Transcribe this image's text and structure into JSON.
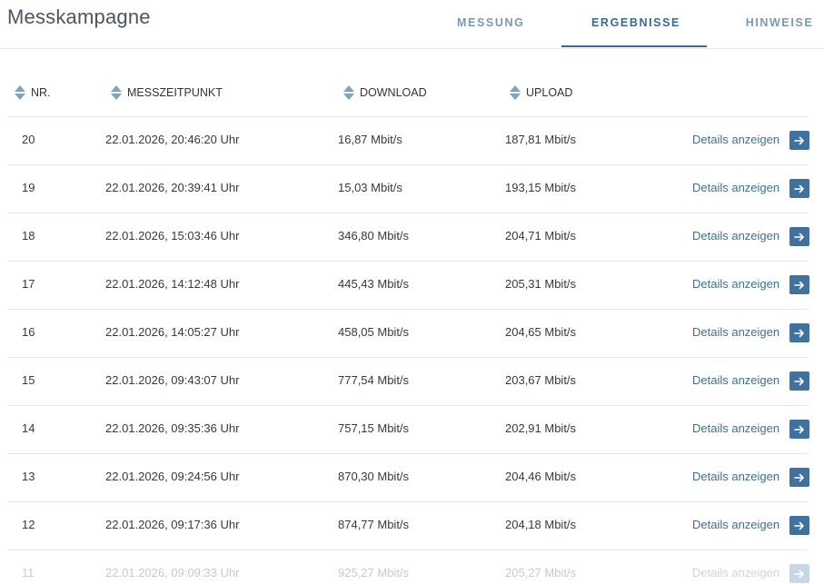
{
  "header": {
    "title": "Messkampagne",
    "tabs": [
      {
        "label": "MESSUNG",
        "active": false
      },
      {
        "label": "ERGEBNISSE",
        "active": true
      },
      {
        "label": "HINWEISE",
        "active": false
      }
    ]
  },
  "table": {
    "columns": [
      {
        "label": "NR.",
        "icon": "sort-icon"
      },
      {
        "label": "MESSZEITPUNKT",
        "icon": "sort-icon"
      },
      {
        "label": "DOWNLOAD",
        "icon": "sort-icon"
      },
      {
        "label": "UPLOAD",
        "icon": "sort-icon"
      }
    ],
    "details_label": "Details anzeigen",
    "action_icon": "arrow-right-icon",
    "rows": [
      {
        "nr": "20",
        "time": "22.01.2026, 20:46:20 Uhr",
        "download": "16,87 Mbit/s",
        "upload": "187,81 Mbit/s"
      },
      {
        "nr": "19",
        "time": "22.01.2026, 20:39:41 Uhr",
        "download": "15,03 Mbit/s",
        "upload": "193,15 Mbit/s"
      },
      {
        "nr": "18",
        "time": "22.01.2026, 15:03:46 Uhr",
        "download": "346,80 Mbit/s",
        "upload": "204,71 Mbit/s"
      },
      {
        "nr": "17",
        "time": "22.01.2026, 14:12:48 Uhr",
        "download": "445,43 Mbit/s",
        "upload": "205,31 Mbit/s"
      },
      {
        "nr": "16",
        "time": "22.01.2026, 14:05:27 Uhr",
        "download": "458,05 Mbit/s",
        "upload": "204,65 Mbit/s"
      },
      {
        "nr": "15",
        "time": "22.01.2026, 09:43:07 Uhr",
        "download": "777,54 Mbit/s",
        "upload": "203,67 Mbit/s"
      },
      {
        "nr": "14",
        "time": "22.01.2026, 09:35:36 Uhr",
        "download": "757,15 Mbit/s",
        "upload": "202,91 Mbit/s"
      },
      {
        "nr": "13",
        "time": "22.01.2026, 09:24:56 Uhr",
        "download": "870,30 Mbit/s",
        "upload": "204,46 Mbit/s"
      },
      {
        "nr": "12",
        "time": "22.01.2026, 09:17:36 Uhr",
        "download": "874,77 Mbit/s",
        "upload": "204,18 Mbit/s"
      },
      {
        "nr": "11",
        "time": "22.01.2026, 09:09:33 Uhr",
        "download": "925,27 Mbit/s",
        "upload": "205,27 Mbit/s"
      }
    ]
  },
  "colors": {
    "accent": "#3f72a0",
    "tab_active": "#3a6a93",
    "tab_inactive": "#7a98b4",
    "sort_icon": "#7aa3c8"
  }
}
